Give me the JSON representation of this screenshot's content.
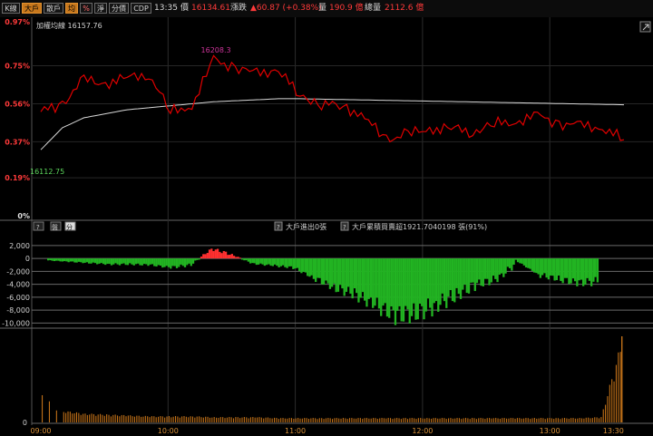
{
  "toolbar": {
    "buttons": [
      {
        "label": "K線",
        "state": "normal"
      },
      {
        "label": "大戶",
        "state": "on"
      },
      {
        "label": "散戶",
        "state": "normal"
      },
      {
        "label": "均",
        "state": "on"
      },
      {
        "label": "%",
        "state": "warn"
      },
      {
        "label": "淨",
        "state": "normal"
      },
      {
        "label": "分價",
        "state": "normal"
      },
      {
        "label": "CDP",
        "state": "normal"
      }
    ],
    "time": "13:35",
    "price_label": "價",
    "price_value": "16134.61",
    "change_label": "漲跌",
    "change_value": "▲60.87 (+0.38%)",
    "volume_label": "量",
    "volume_value": "190.9 億",
    "total_label": "總量",
    "total_value": "2112.6 億"
  },
  "top_panel": {
    "title": "加權均線 16157.76",
    "y_ticks": [
      "0.97%",
      "0.75%",
      "0.56%",
      "0.37%",
      "0.19%",
      "0%"
    ],
    "high_label": "16208.3",
    "low_label": "16112.75",
    "expand_icon": "diagonal-arrow-icon"
  },
  "mid_panel": {
    "tabs": [
      "?",
      "盤",
      "分"
    ],
    "legend_a_icon": "?",
    "legend_a": "大戶進出0張",
    "legend_b_icon": "?",
    "legend_b": "大戶累積買賣超1921.7040198 張(91%)",
    "y_ticks": [
      "2,000",
      "0",
      "-2,000",
      "-4,000",
      "-6,000",
      "-8,000",
      "-10,000"
    ]
  },
  "bottom_panel": {
    "y_ticks": [
      "0"
    ],
    "x_ticks": [
      "09:00",
      "10:00",
      "11:00",
      "12:00",
      "13:00",
      "13:30"
    ]
  },
  "colors": {
    "price_line": "#e00000",
    "avg_line": "#d8d8d8",
    "up": "#ff3030",
    "down": "#22b422",
    "volume": "#c07018",
    "grid": "#383838",
    "vgrid": "#2c2c2c"
  },
  "chart_data": [
    {
      "type": "line",
      "title": "加權均線 16157.76",
      "x": [
        "09:00",
        "09:10",
        "09:20",
        "09:30",
        "09:40",
        "09:50",
        "10:00",
        "10:10",
        "10:20",
        "10:30",
        "10:40",
        "10:50",
        "11:00",
        "11:10",
        "11:20",
        "11:30",
        "11:40",
        "11:50",
        "12:00",
        "12:10",
        "12:20",
        "12:30",
        "12:40",
        "12:50",
        "13:00",
        "13:10",
        "13:20",
        "13:30"
      ],
      "ylim": [
        0,
        0.97
      ],
      "series": [
        {
          "name": "",
          "values": [
            0.52,
            0.56,
            0.68,
            0.66,
            0.69,
            0.71,
            0.52,
            0.55,
            0.78,
            0.74,
            0.71,
            0.73,
            0.6,
            0.56,
            0.55,
            0.49,
            0.38,
            0.41,
            0.43,
            0.44,
            0.42,
            0.46,
            0.47,
            0.5,
            0.46,
            0.45,
            0.44,
            0.38
          ]
        },
        {
          "name": "",
          "values": [
            0.33,
            0.44,
            0.49,
            0.51,
            0.53,
            0.54,
            0.55,
            0.56,
            0.57,
            0.575,
            0.58,
            0.585,
            0.585,
            0.583,
            0.581,
            0.579,
            0.577,
            0.575,
            0.573,
            0.571,
            0.569,
            0.567,
            0.565,
            0.563,
            0.561,
            0.559,
            0.557,
            0.555
          ]
        }
      ]
    },
    {
      "type": "bar",
      "x": [
        "09:00",
        "09:10",
        "09:20",
        "09:30",
        "09:40",
        "09:50",
        "10:00",
        "10:10",
        "10:20",
        "10:30",
        "10:40",
        "10:50",
        "11:00",
        "11:10",
        "11:20",
        "11:30",
        "11:40",
        "11:50",
        "12:00",
        "12:10",
        "12:20",
        "12:30",
        "12:40",
        "12:50",
        "13:00",
        "13:10",
        "13:20",
        "13:30"
      ],
      "ylim": [
        -10500,
        2400
      ],
      "values": [
        -300,
        -500,
        -700,
        -900,
        -900,
        -1000,
        -1400,
        -1000,
        1500,
        600,
        -800,
        -1100,
        -1400,
        -3000,
        -4500,
        -5500,
        -7200,
        -8800,
        -8500,
        -7200,
        -5600,
        -4000,
        -3200,
        -500,
        -2500,
        -3200,
        -3800,
        -3500
      ]
    },
    {
      "type": "bar",
      "x": [
        "09:00",
        "09:10",
        "09:20",
        "09:30",
        "09:40",
        "09:50",
        "10:00",
        "10:10",
        "10:20",
        "10:30",
        "10:40",
        "10:50",
        "11:00",
        "11:10",
        "11:20",
        "11:30",
        "11:40",
        "11:50",
        "12:00",
        "12:10",
        "12:20",
        "12:30",
        "12:40",
        "12:50",
        "13:00",
        "13:10",
        "13:20",
        "13:30"
      ],
      "values": [
        40,
        13,
        10,
        9,
        8,
        7,
        7,
        7,
        6,
        6,
        6,
        5,
        5,
        5,
        5,
        5,
        5,
        5,
        5,
        5,
        5,
        5,
        5,
        5,
        5,
        5,
        6,
        95
      ]
    }
  ]
}
